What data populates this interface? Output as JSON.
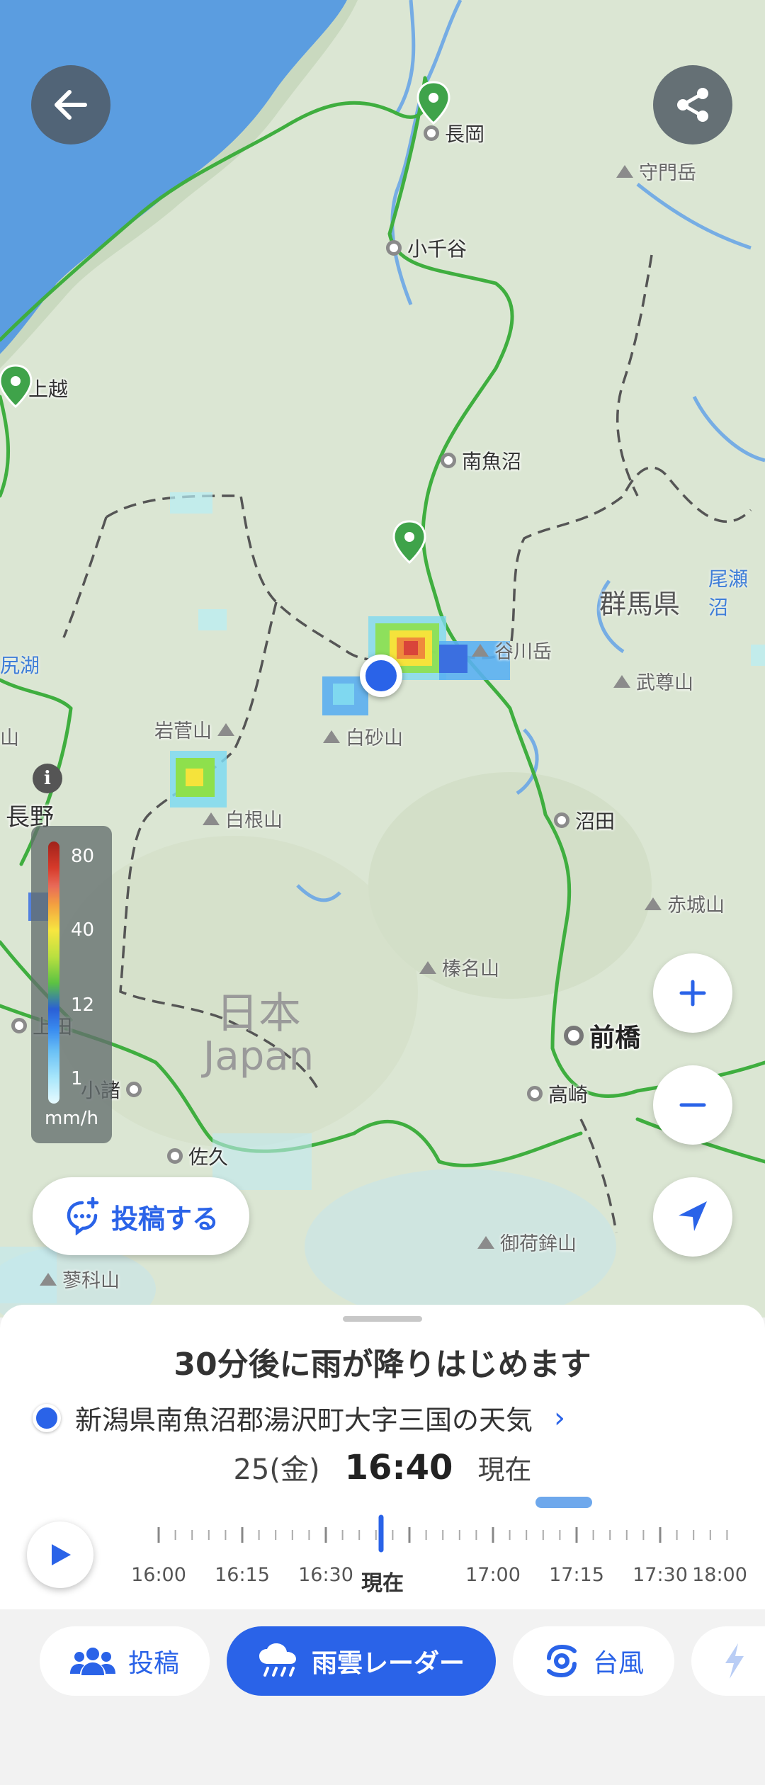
{
  "map": {
    "places": [
      {
        "name": "長岡",
        "major": false
      },
      {
        "name": "小千谷",
        "major": false
      },
      {
        "name": "上越",
        "major": false
      },
      {
        "name": "南魚沼",
        "major": false
      },
      {
        "name": "沼田",
        "major": false
      },
      {
        "name": "前橋",
        "major": true
      },
      {
        "name": "高崎",
        "major": false
      },
      {
        "name": "小諸",
        "major": false
      },
      {
        "name": "佐久",
        "major": false
      },
      {
        "name": "長野",
        "major": false
      },
      {
        "name": "上田",
        "major": false
      }
    ],
    "mountains": [
      "守門岳",
      "谷川岳",
      "武尊山",
      "白砂山",
      "岩菅山",
      "白根山",
      "赤城山",
      "榛名山",
      "御荷鉾山",
      "蓼科山"
    ],
    "prefecture_label": "群馬県",
    "water_labels": [
      "尾瀬沼",
      "尻湖"
    ],
    "country_label": {
      "ja": "日本",
      "en": "Japan"
    },
    "mountain_partial": "山"
  },
  "legend": {
    "ticks": [
      "80",
      "40",
      "12",
      "1"
    ],
    "unit": "mm/h"
  },
  "post_button": {
    "label": "投稿する"
  },
  "sheet": {
    "headline": "30分後に雨が降りはじめます",
    "location": "新潟県南魚沼郡湯沢町大字三国の天気",
    "date": "25(金)",
    "time": "16:40",
    "now_label": "現在"
  },
  "timeline": {
    "labels": [
      "16:00",
      "16:15",
      "16:30",
      "現在",
      "17:00",
      "17:15",
      "17:30",
      "18:00"
    ],
    "current_label": "現在"
  },
  "nav": {
    "items": [
      {
        "label": "投稿",
        "icon": "people-icon",
        "active": false
      },
      {
        "label": "雨雲レーダー",
        "icon": "rain-cloud-icon",
        "active": true
      },
      {
        "label": "台風",
        "icon": "typhoon-icon",
        "active": false
      }
    ]
  },
  "colors": {
    "accent": "#2a63e8",
    "road": "#3fae3f",
    "sea": "#5b9de0"
  }
}
